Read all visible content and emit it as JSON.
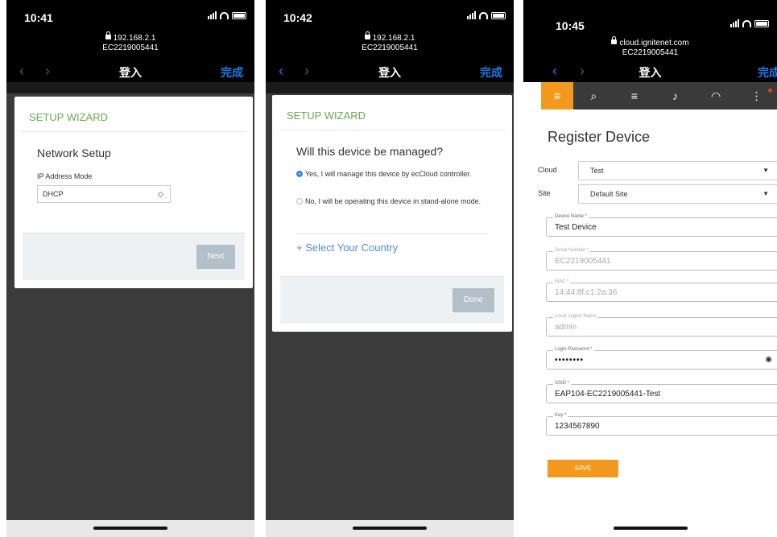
{
  "screen1": {
    "status": {
      "time": "10:41"
    },
    "url": {
      "host": "192.168.2.1",
      "path": "EC2219005441"
    },
    "nav": {
      "title": "登入",
      "done": "完成",
      "back": "‹",
      "forward": "›"
    },
    "wizard": {
      "title": "SETUP WIZARD",
      "heading": "Network Setup",
      "field_label": "IP Address Mode",
      "select_value": "DHCP",
      "next_label": "Next"
    }
  },
  "screen2": {
    "status": {
      "time": "10:42"
    },
    "url": {
      "host": "192.168.2.1",
      "path": "EC2219005441"
    },
    "nav": {
      "title": "登入",
      "done": "完成",
      "back": "‹",
      "forward": "›"
    },
    "wizard": {
      "title": "SETUP WIZARD",
      "question": "Will this device be managed?",
      "option_yes": "Yes, I will manage this device by ecCloud controller.",
      "option_no": "No, I will be operating this device in stand-alone mode.",
      "select_country": "+ Select Your Country",
      "done_label": "Done"
    }
  },
  "screen3": {
    "status": {
      "time": "10:45"
    },
    "url": {
      "host": "cloud.ignitenet.com",
      "path": "EC2219005441"
    },
    "nav": {
      "title": "登入",
      "done": "完成",
      "back": "‹",
      "forward": "›"
    },
    "toolbar": {
      "menu": "≡",
      "search": "⌕",
      "list": "≡",
      "bell": "♪",
      "antenna": "◠",
      "more": "⋮"
    },
    "page_title": "Register Device",
    "cloud": {
      "label": "Cloud",
      "value": "Test"
    },
    "site": {
      "label": "Site",
      "value": "Default Site"
    },
    "fields": [
      {
        "legend": "Device Name *",
        "value": "Test Device",
        "disabled": false
      },
      {
        "legend": "Serial Number *",
        "value": "EC2219005441",
        "disabled": true
      },
      {
        "legend": "MAC *",
        "value": "14:44:8f:c1:2a:36",
        "disabled": true
      },
      {
        "legend": "Local Logins Name",
        "value": "admin",
        "disabled": true
      },
      {
        "legend": "Login Password *",
        "value": "••••••••",
        "disabled": false
      },
      {
        "legend": "SSID *",
        "value": "EAP104-EC2219005441-Test",
        "disabled": false
      },
      {
        "legend": "Key *",
        "value": "1234567890",
        "disabled": false
      }
    ],
    "save_label": "SAVE",
    "colors": {
      "accent": "#f39a1e",
      "toolbar": "#3a3a3a"
    }
  }
}
